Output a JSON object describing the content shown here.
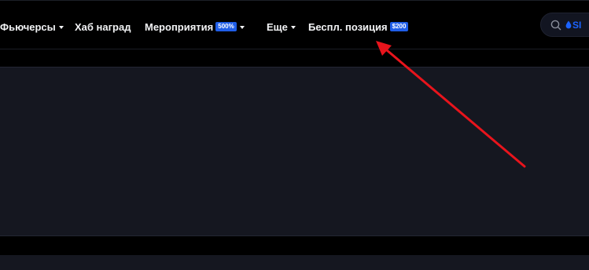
{
  "nav": {
    "futures": {
      "label": "Фьючерсы"
    },
    "rewards_hub": {
      "label": "Хаб наград"
    },
    "events": {
      "label": "Мероприятия",
      "badge": "500%"
    },
    "more": {
      "label": "Еще"
    },
    "free_position": {
      "label": "Беспл. позиция",
      "badge": "$200"
    }
  },
  "search": {
    "icon": "search-icon",
    "tag_text": "SI",
    "tag_icon": "drop-icon"
  },
  "annotation": {
    "color": "#e8141c",
    "shape": "arrow"
  },
  "colors": {
    "background": "#000000",
    "panel": "#151720",
    "badge": "#1f5ee8",
    "nav_text": "#f2f3f5",
    "accent": "#1b63ff"
  }
}
